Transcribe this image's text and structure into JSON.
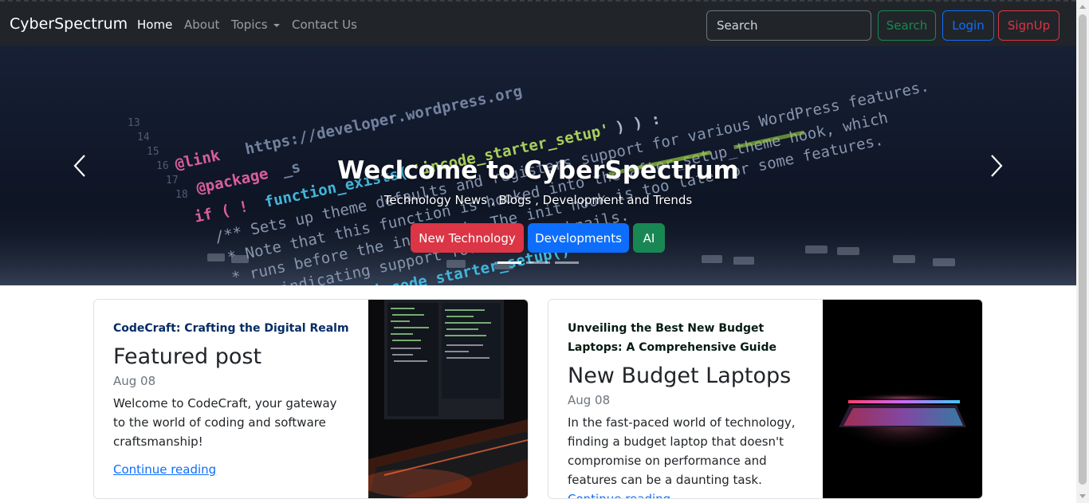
{
  "navbar": {
    "brand": "CyberSpectrum",
    "links": [
      "Home",
      "About",
      "Topics",
      "Contact Us"
    ],
    "search_placeholder": "Search",
    "search_button": "Search",
    "login_button": "Login",
    "signup_button": "SignUp"
  },
  "hero": {
    "title": "Weclcome to CyberSpectrum",
    "subtitle": "Technology News , Blogs , Development and Trends",
    "buttons": [
      "New Technology",
      "Developments",
      "AI"
    ],
    "active_slide": 1,
    "slide_count": 3
  },
  "cards": [
    {
      "category": "CodeCraft: Crafting the Digital Realm",
      "title": "Featured post",
      "date": "Aug 08",
      "text": "Welcome to CodeCraft, your gateway to the world of coding and software craftsmanship!",
      "link": "Continue reading"
    },
    {
      "category": "Unveiling the Best New Budget Laptops: A Comprehensive Guide",
      "title": "New Budget Laptops",
      "date": "Aug 08",
      "text": "In the fast-paced world of technology, finding a budget laptop that doesn't compromise on performance and features can be a daunting task.",
      "link": "Continue reading"
    }
  ],
  "colors": {
    "navbar_bg": "#212529",
    "success": "#198754",
    "primary": "#0d6efd",
    "danger": "#dc3545",
    "card1_category": "#052c65",
    "card2_category": "#051b11"
  }
}
